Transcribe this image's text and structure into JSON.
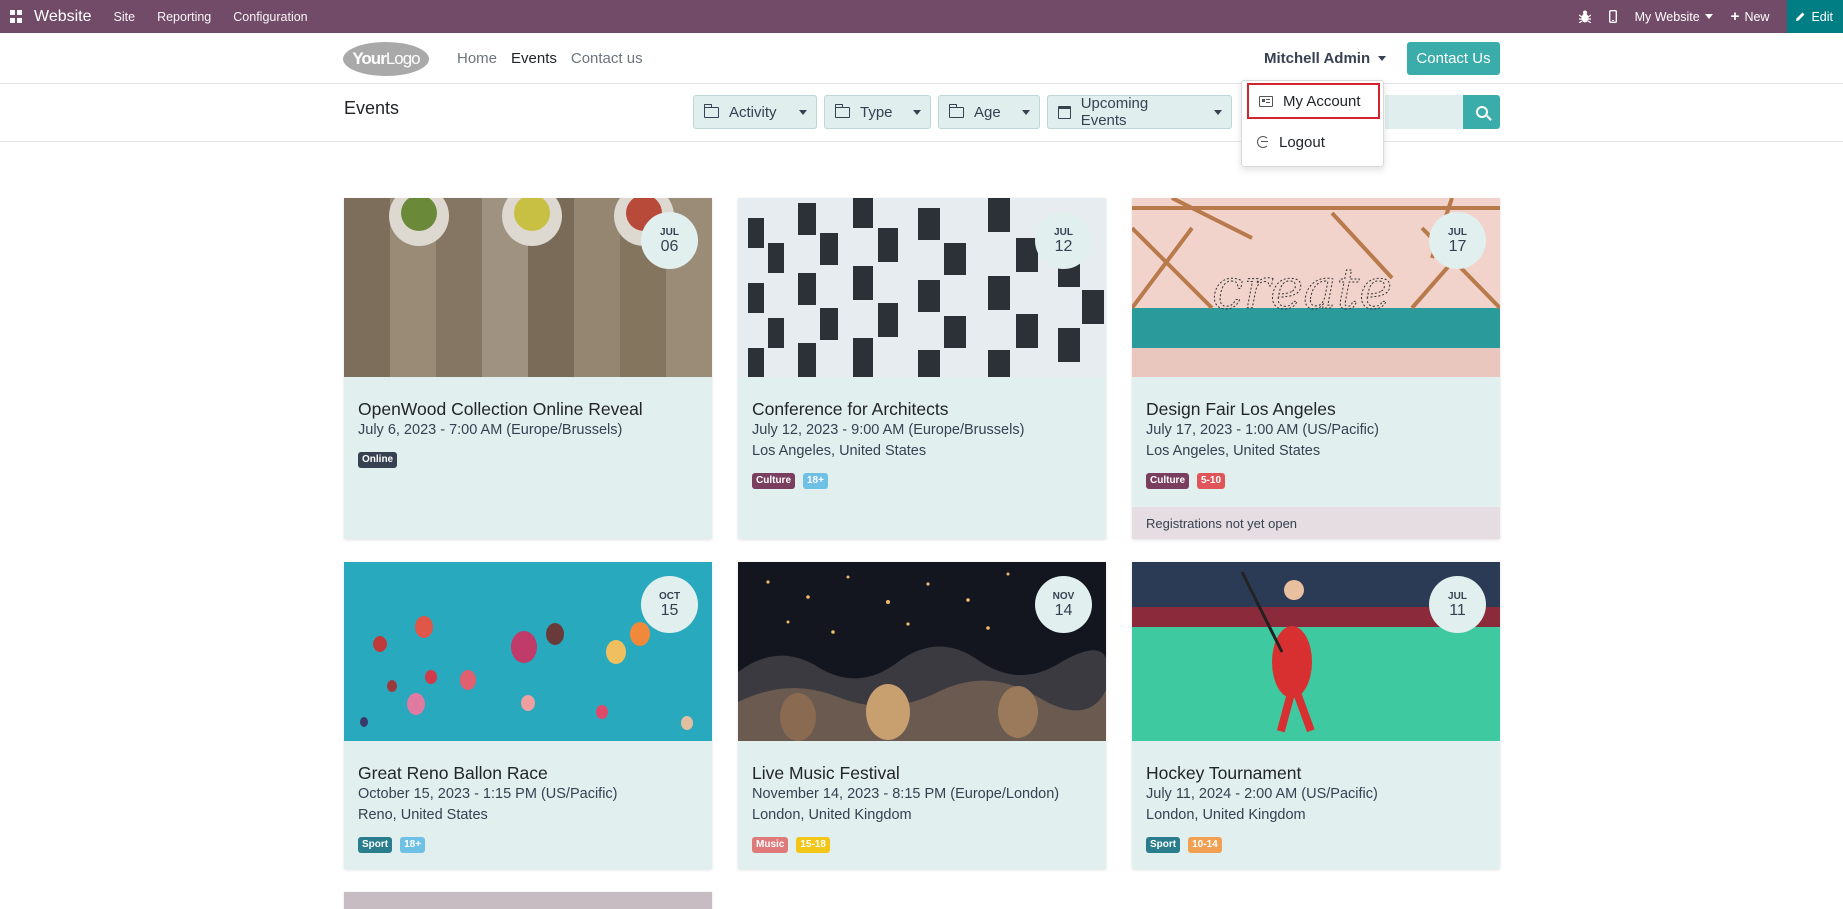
{
  "adminbar": {
    "brand": "Website",
    "menus": [
      "Site",
      "Reporting",
      "Configuration"
    ],
    "website": "My Website",
    "new_label": "New",
    "edit_label": "Edit"
  },
  "header": {
    "logo_text_bold": "Your",
    "logo_text_thin": "Logo",
    "nav": [
      "Home",
      "Events",
      "Contact us"
    ],
    "user": "Mitchell Admin",
    "contact_button": "Contact Us"
  },
  "subhead": {
    "title": "Events",
    "filters": [
      "Activity",
      "Type",
      "Age",
      "Upcoming Events"
    ]
  },
  "dropdown": {
    "my_account": "My Account",
    "logout": "Logout"
  },
  "events": [
    {
      "month": "JUL",
      "day": "06",
      "title": "OpenWood Collection Online Reveal",
      "when": "July 6, 2023 - 7:00 AM (Europe/Brussels)",
      "where": "",
      "tags": [
        {
          "label": "Online",
          "color": "#374151"
        }
      ],
      "status": ""
    },
    {
      "month": "JUL",
      "day": "12",
      "title": "Conference for Architects",
      "when": "July 12, 2023 - 9:00 AM (Europe/Brussels)",
      "where": "Los Angeles, United States",
      "tags": [
        {
          "label": "Culture",
          "color": "#7A3E5E"
        },
        {
          "label": "18+",
          "color": "#6EC1E4"
        }
      ],
      "status": ""
    },
    {
      "month": "JUL",
      "day": "17",
      "title": "Design Fair Los Angeles",
      "when": "July 17, 2023 - 1:00 AM (US/Pacific)",
      "where": "Los Angeles, United States",
      "tags": [
        {
          "label": "Culture",
          "color": "#7A3E5E"
        },
        {
          "label": "5-10",
          "color": "#E0555A"
        }
      ],
      "status": "Registrations not yet open"
    },
    {
      "month": "OCT",
      "day": "15",
      "title": "Great Reno Ballon Race",
      "when": "October 15, 2023 - 1:15 PM (US/Pacific)",
      "where": "Reno, United States",
      "tags": [
        {
          "label": "Sport",
          "color": "#2A7D8C"
        },
        {
          "label": "18+",
          "color": "#6EC1E4"
        }
      ],
      "status": ""
    },
    {
      "month": "NOV",
      "day": "14",
      "title": "Live Music Festival",
      "when": "November 14, 2023 - 8:15 PM (Europe/London)",
      "where": "London, United Kingdom",
      "tags": [
        {
          "label": "Music",
          "color": "#E07A7A"
        },
        {
          "label": "15-18",
          "color": "#F2C516"
        }
      ],
      "status": ""
    },
    {
      "month": "JUL",
      "day": "11",
      "title": "Hockey Tournament",
      "when": "July 11, 2024 - 2:00 AM (US/Pacific)",
      "where": "London, United Kingdom",
      "tags": [
        {
          "label": "Sport",
          "color": "#2A7D8C"
        },
        {
          "label": "10-14",
          "color": "#F0A050"
        }
      ],
      "status": ""
    }
  ]
}
